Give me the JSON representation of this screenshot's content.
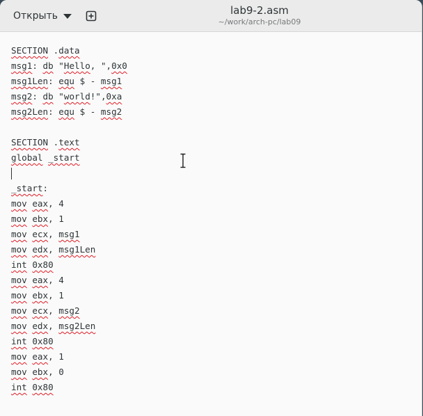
{
  "header": {
    "open_label": "Открыть",
    "new_tab_icon": "plus-square-icon",
    "title": "lab9-2.asm",
    "path": "~/work/arch-pc/lab09"
  },
  "colors": {
    "headerbar": "#ebebeb",
    "editor_bg": "#fafafa",
    "text": "#2e3436",
    "spellcheck": "#e01b24"
  },
  "editor": {
    "cursor_line": 8,
    "lines": [
      "SECTION .data",
      "msg1: db \"Hello, \",0x0",
      "msg1Len: equ $ - msg1",
      "msg2: db \"world!\",0xa",
      "msg2Len: equ $ - msg2",
      "",
      "SECTION .text",
      "global _start",
      "",
      "_start:",
      "mov eax, 4",
      "mov ebx, 1",
      "mov ecx, msg1",
      "mov edx, msg1Len",
      "int 0x80",
      "mov eax, 4",
      "mov ebx, 1",
      "mov ecx, msg2",
      "mov edx, msg2Len",
      "int 0x80",
      "mov eax, 1",
      "mov ebx, 0",
      "int 0x80"
    ]
  }
}
